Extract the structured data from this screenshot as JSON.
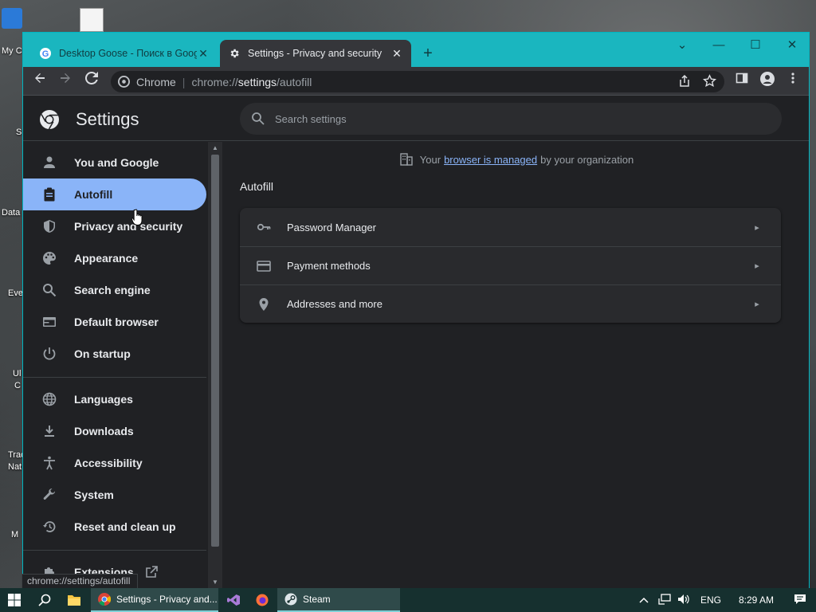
{
  "desktop": {
    "icons": [
      {
        "label": "My C"
      },
      {
        "label": "S"
      },
      {
        "label": "Data"
      },
      {
        "label": "Eve"
      },
      {
        "label": "Ul"
      },
      {
        "label": "C"
      },
      {
        "label": "Trac"
      },
      {
        "label": "Nat"
      },
      {
        "label": "M"
      }
    ]
  },
  "browser": {
    "tabs": [
      {
        "title": "Desktop Goose - Поиск в Googl",
        "favicon": "google-icon",
        "active": false
      },
      {
        "title": "Settings - Privacy and security",
        "favicon": "gear-icon",
        "active": true
      }
    ],
    "new_tab": "+",
    "window_controls": {
      "dropdown": "⌄",
      "minimize": "—",
      "maximize": "☐",
      "close": "✕"
    },
    "omnibox": {
      "site_label": "Chrome",
      "url_prefix": "chrome://",
      "url_host": "settings",
      "url_path": "/autofill"
    }
  },
  "settings": {
    "title": "Settings",
    "search_placeholder": "Search settings",
    "managed_notice": {
      "prefix": "Your",
      "link": "browser is managed",
      "suffix": "by your organization"
    },
    "nav": [
      {
        "label": "You and Google",
        "icon": "person-icon",
        "selected": false
      },
      {
        "label": "Autofill",
        "icon": "clipboard-icon",
        "selected": true
      },
      {
        "label": "Privacy and security",
        "icon": "shield-icon",
        "selected": false
      },
      {
        "label": "Appearance",
        "icon": "palette-icon",
        "selected": false
      },
      {
        "label": "Search engine",
        "icon": "search-icon",
        "selected": false
      },
      {
        "label": "Default browser",
        "icon": "browser-window-icon",
        "selected": false
      },
      {
        "label": "On startup",
        "icon": "power-icon",
        "selected": false
      },
      {
        "label": "Languages",
        "icon": "globe-icon",
        "selected": false
      },
      {
        "label": "Downloads",
        "icon": "download-icon",
        "selected": false
      },
      {
        "label": "Accessibility",
        "icon": "accessibility-icon",
        "selected": false
      },
      {
        "label": "System",
        "icon": "wrench-icon",
        "selected": false
      },
      {
        "label": "Reset and clean up",
        "icon": "restore-icon",
        "selected": false
      },
      {
        "label": "Extensions",
        "icon": "puzzle-icon",
        "selected": false
      }
    ],
    "section_title": "Autofill",
    "rows": [
      {
        "label": "Password Manager",
        "icon": "key-icon"
      },
      {
        "label": "Payment methods",
        "icon": "credit-card-icon"
      },
      {
        "label": "Addresses and more",
        "icon": "location-pin-icon"
      }
    ]
  },
  "status_bubble": "chrome://settings/autofill",
  "taskbar": {
    "items": [
      {
        "label": "Settings - Privacy and...",
        "icon": "chrome-icon",
        "active": true
      },
      {
        "label": "",
        "icon": "visual-studio-icon",
        "active": false
      },
      {
        "label": "",
        "icon": "firefox-icon",
        "active": false
      },
      {
        "label": "Steam",
        "icon": "steam-icon",
        "active": true
      }
    ],
    "language": "ENG",
    "time": "8:29 AM"
  },
  "colors": {
    "titlebar": "#1ab6bf",
    "selected_nav": "#8ab4f8",
    "link": "#8ab4f8",
    "page_bg": "#202124"
  }
}
